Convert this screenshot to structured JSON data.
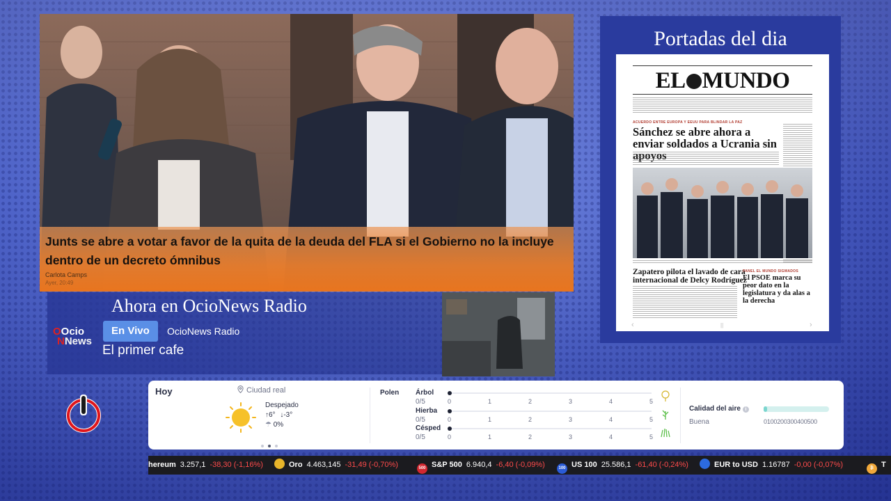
{
  "news": {
    "title": "Junts se abre a votar a favor de la quita de la deuda del FLA si el Gobierno no la incluye dentro de un decreto ómnibus",
    "author": "Carlota Camps",
    "date": "Ayer, 20:49",
    "caption_color": "#ee8a3a"
  },
  "portadas": {
    "title": "Portadas del dia",
    "newspaper": {
      "logo_left": "EL",
      "logo_right": "MUNDO",
      "tag": "ACUERDO ENTRE EUROPA Y EEUU PARA BLINDAR LA PAZ",
      "headline": "Sánchez se abre ahora a enviar soldados a Ucrania sin apoyos",
      "headline2": "Zapatero pilota el lavado de cara internacional de Delcy Rodríguez",
      "headline3_tag": "PANEL EL MUNDO SIGMADOS",
      "headline3": "El PSOE marca su peor dato en la legislatura y da alas a la derecha"
    },
    "nav_prev": "‹",
    "nav_pause": "||",
    "nav_next": "›"
  },
  "radio": {
    "heading": "Ahora en OcioNews Radio",
    "logo_top": "Ocio",
    "logo_bottom": "News",
    "live_label": "En Vivo",
    "station": "OcioNews Radio",
    "program": "El primer cafe"
  },
  "weather": {
    "day_label": "Hoy",
    "city": "Ciudad real",
    "condition": "Despejado",
    "temp_max": "6°",
    "temp_min": "-3°",
    "rain": "0%",
    "icon": "sun-icon",
    "carousel_active_index": 1,
    "polen": {
      "label": "Polen",
      "scale": [
        "0",
        "1",
        "2",
        "3",
        "4",
        "5"
      ],
      "items": [
        {
          "name": "Árbol",
          "value": "0/5",
          "level": 0,
          "icon": "tree-icon"
        },
        {
          "name": "Hierba",
          "value": "0/5",
          "level": 0,
          "icon": "grass-icon"
        },
        {
          "name": "Césped",
          "value": "0/5",
          "level": 0,
          "icon": "lawn-icon"
        }
      ]
    },
    "air": {
      "label": "Calidad del aire",
      "status": "Buena",
      "level": 0.05,
      "scale": [
        "0",
        "100",
        "200",
        "300",
        "400",
        "500"
      ]
    }
  },
  "ticker": [
    {
      "name": "hereum",
      "price": "3.257,1",
      "change": "-38,30 (-1,16%)",
      "badge": "",
      "badge_color": ""
    },
    {
      "name": "Oro",
      "price": "4.463,145",
      "change": "-31,49 (-0,70%)",
      "badge": "",
      "badge_color": "#e8b52a"
    },
    {
      "name": "S&P 500",
      "price": "6.940,4",
      "change": "-6,40 (-0,09%)",
      "badge": "500",
      "badge_color": "#d2272f"
    },
    {
      "name": "US 100",
      "price": "25.586,1",
      "change": "-61,40 (-0,24%)",
      "badge": "100",
      "badge_color": "#2a5bd7"
    },
    {
      "name": "EUR to USD",
      "price": "1.16787",
      "change": "-0,00 (-0,07%)",
      "badge": "",
      "badge_color": "#2c6be0"
    },
    {
      "name": "",
      "price": "",
      "change": "",
      "badge": "T",
      "badge_color": "#f2a93b"
    }
  ]
}
